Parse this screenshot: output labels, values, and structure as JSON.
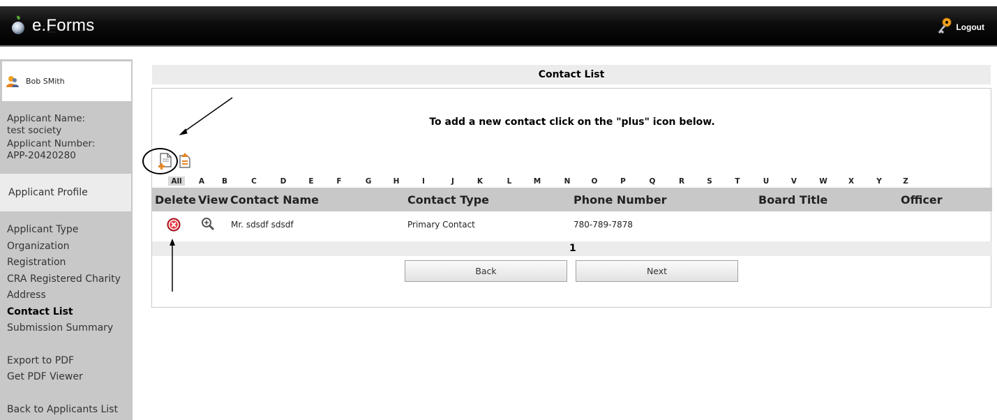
{
  "header": {
    "app_name": "e.Forms",
    "logout_label": "Logout"
  },
  "sidebar": {
    "user_name": "Bob SMith",
    "applicant_name_label": "Applicant Name:",
    "applicant_name_value": "test society",
    "applicant_number_label": "Applicant Number:",
    "applicant_number_value": "APP-20420280",
    "profile_label": "Applicant Profile",
    "nav": [
      "Applicant Type",
      "Organization",
      "Registration",
      "CRA Registered Charity",
      "Address",
      "Contact List",
      "Submission Summary"
    ],
    "active_item": "Contact List",
    "export_pdf": "Export to PDF",
    "get_pdf_viewer": "Get PDF Viewer",
    "back_to_list": "Back to Applicants List"
  },
  "main": {
    "title": "Contact List",
    "instruction": "To add a new contact click on the \"plus\" icon below.",
    "alphabet": [
      "All",
      "A",
      "B",
      "C",
      "D",
      "E",
      "F",
      "G",
      "H",
      "I",
      "J",
      "K",
      "L",
      "M",
      "N",
      "O",
      "P",
      "Q",
      "R",
      "S",
      "T",
      "U",
      "V",
      "W",
      "X",
      "Y",
      "Z"
    ],
    "selected_letter": "All",
    "columns": [
      "Delete",
      "View",
      "Contact Name",
      "Contact Type",
      "Phone Number",
      "Board Title",
      "Officer"
    ],
    "rows": [
      {
        "contact_name": "Mr. sdsdf sdsdf",
        "contact_type": "Primary Contact",
        "phone": "780-789-7878",
        "board_title": "",
        "officer": ""
      }
    ],
    "page": "1",
    "back_label": "Back",
    "next_label": "Next"
  },
  "colors": {
    "header_bg": "#000000",
    "sidebar_bg": "#c8c8c8",
    "table_header_bg": "#c8c8c8",
    "delete_red": "#d0202c",
    "accent_orange": "#e8821e"
  }
}
